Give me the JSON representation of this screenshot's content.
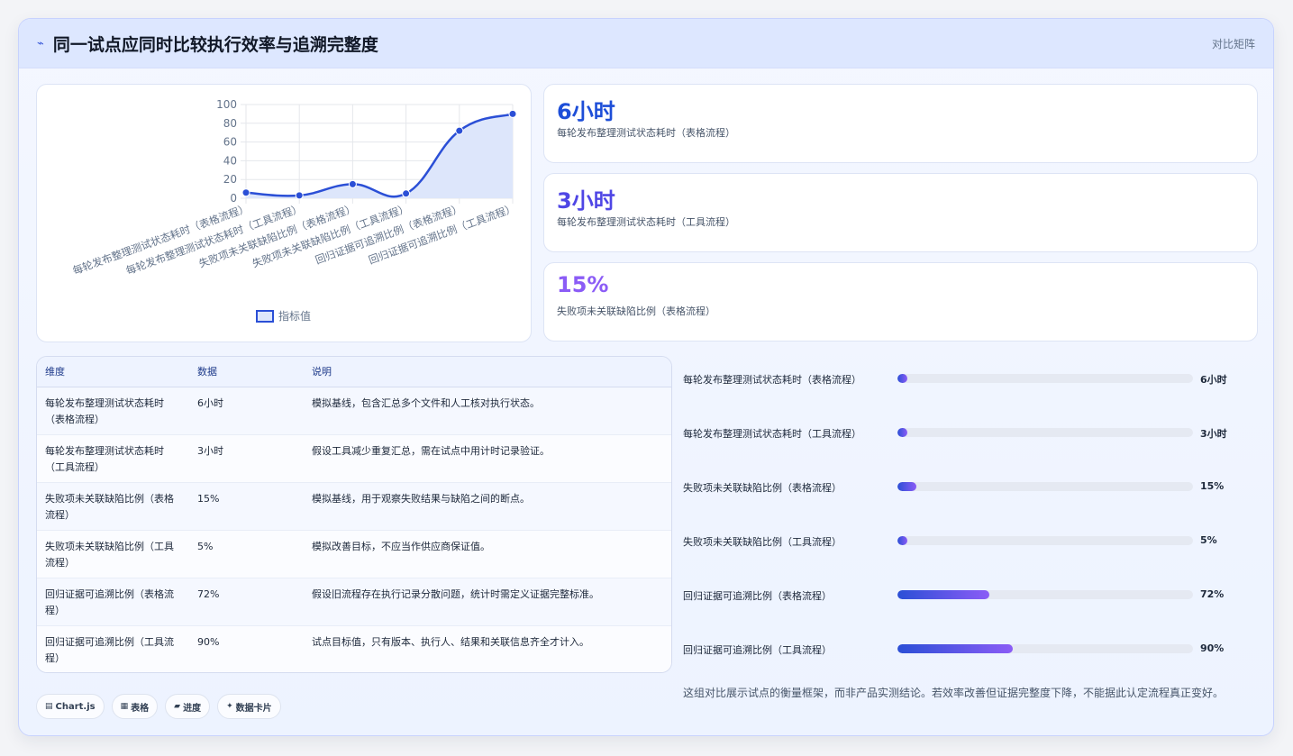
{
  "header": {
    "icon": "trend-icon",
    "title": "同一试点应同时比较执行效率与追溯完整度",
    "tag": "对比矩阵"
  },
  "chart_data": {
    "type": "line",
    "categories": [
      "每轮发布整理测试状态耗时（表格流程）",
      "每轮发布整理测试状态耗时（工具流程）",
      "失败项未关联缺陷比例（表格流程）",
      "失败项未关联缺陷比例（工具流程）",
      "回归证据可追溯比例（表格流程）",
      "回归证据可追溯比例（工具流程）"
    ],
    "series": [
      {
        "name": "指标值",
        "values": [
          6,
          3,
          15,
          5,
          72,
          90
        ]
      }
    ],
    "ylim": [
      0,
      100
    ],
    "yticks": [
      "0",
      "20",
      "40",
      "60",
      "80",
      "100"
    ],
    "grid": true,
    "legend": "bottom",
    "color": "#2b4fd6",
    "fill": "#dde6fb"
  },
  "kpis": [
    {
      "value": "6小时",
      "label": "每轮发布整理测试状态耗时（表格流程）",
      "color": "#1d4ed8"
    },
    {
      "value": "3小时",
      "label": "每轮发布整理测试状态耗时（工具流程）",
      "color": "#4f46e5"
    },
    {
      "value": "15%",
      "label": "失败项未关联缺陷比例（表格流程）",
      "color": "#8b5cf6"
    }
  ],
  "table": {
    "headers": [
      "维度",
      "数据",
      "说明"
    ],
    "rows": [
      [
        "每轮发布整理测试状态耗时（表格流程）",
        "6小时",
        "模拟基线，包含汇总多个文件和人工核对执行状态。"
      ],
      [
        "每轮发布整理测试状态耗时（工具流程）",
        "3小时",
        "假设工具减少重复汇总，需在试点中用计时记录验证。"
      ],
      [
        "失败项未关联缺陷比例（表格流程）",
        "15%",
        "模拟基线，用于观察失败结果与缺陷之间的断点。"
      ],
      [
        "失败项未关联缺陷比例（工具流程）",
        "5%",
        "模拟改善目标，不应当作供应商保证值。"
      ],
      [
        "回归证据可追溯比例（表格流程）",
        "72%",
        "假设旧流程存在执行记录分散问题，统计时需定义证据完整标准。"
      ],
      [
        "回归证据可追溯比例（工具流程）",
        "90%",
        "试点目标值，只有版本、执行人、结果和关联信息齐全才计入。"
      ]
    ]
  },
  "progress": [
    {
      "label": "每轮发布整理测试状态耗时（表格流程）",
      "value": "6小时",
      "fraction": 0.035
    },
    {
      "label": "每轮发布整理测试状态耗时（工具流程）",
      "value": "3小时",
      "fraction": 0.035
    },
    {
      "label": "失败项未关联缺陷比例（表格流程）",
      "value": "15%",
      "fraction": 0.065
    },
    {
      "label": "失败项未关联缺陷比例（工具流程）",
      "value": "5%",
      "fraction": 0.035
    },
    {
      "label": "回归证据可追溯比例（表格流程）",
      "value": "72%",
      "fraction": 0.31
    },
    {
      "label": "回归证据可追溯比例（工具流程）",
      "value": "90%",
      "fraction": 0.39
    }
  ],
  "note": "这组对比展示试点的衡量框架，而非产品实测结论。若效率改善但证据完整度下降，不能据此认定流程真正变好。",
  "pills": [
    {
      "icon": "▤",
      "label": "Chart.js"
    },
    {
      "icon": "▦",
      "label": "表格"
    },
    {
      "icon": "▰",
      "label": "进度"
    },
    {
      "icon": "✦",
      "label": "数据卡片"
    }
  ]
}
